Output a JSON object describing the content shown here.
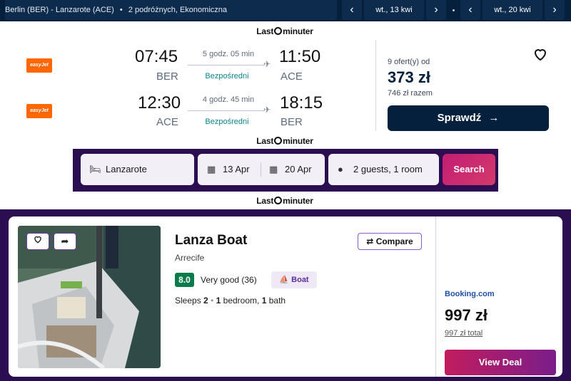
{
  "top_bar": {
    "route": "Berlin (BER) - Lanzarote (ACE)",
    "details": "2 podróżnych, Ekonomiczna",
    "outbound_date": "wt., 13 kwi",
    "return_date": "wt., 20 kwi"
  },
  "brand": {
    "name_left": "Last",
    "name_right": "minuter"
  },
  "flight": {
    "outbound": {
      "airline": "easyJet",
      "depart_time": "07:45",
      "depart_code": "BER",
      "duration": "5 godz. 05 min",
      "stops": "Bezpośredni",
      "arrive_time": "11:50",
      "arrive_code": "ACE"
    },
    "inbound": {
      "airline": "easyJet",
      "depart_time": "12:30",
      "depart_code": "ACE",
      "duration": "4 godz. 45 min",
      "stops": "Bezpośredni",
      "arrive_time": "18:15",
      "arrive_code": "BER"
    },
    "offers": "9 ofert(y) od",
    "price": "373 zł",
    "total": "746 zł razem",
    "cta": "Sprawdź"
  },
  "search": {
    "destination": "Lanzarote",
    "checkin": "13 Apr",
    "checkout": "20 Apr",
    "guests": "2 guests, 1 room",
    "button": "Search"
  },
  "hotel": {
    "name": "Lanza Boat",
    "city": "Arrecife",
    "compare": "Compare",
    "score": "8.0",
    "score_text": "Very good (36)",
    "type": "Boat",
    "sleeps_label": "Sleeps",
    "sleeps": "2",
    "bedrooms": "1",
    "bedrooms_label": "bedroom,",
    "baths": "1",
    "baths_label": "bath",
    "provider": "Booking.com",
    "price": "997 zł",
    "price_total": "997 zł total",
    "cta": "View Deal"
  },
  "colors": {
    "navy": "#05203c",
    "purple": "#2b0d52",
    "green": "#0a7b4a",
    "easyjet": "#ff6600"
  }
}
